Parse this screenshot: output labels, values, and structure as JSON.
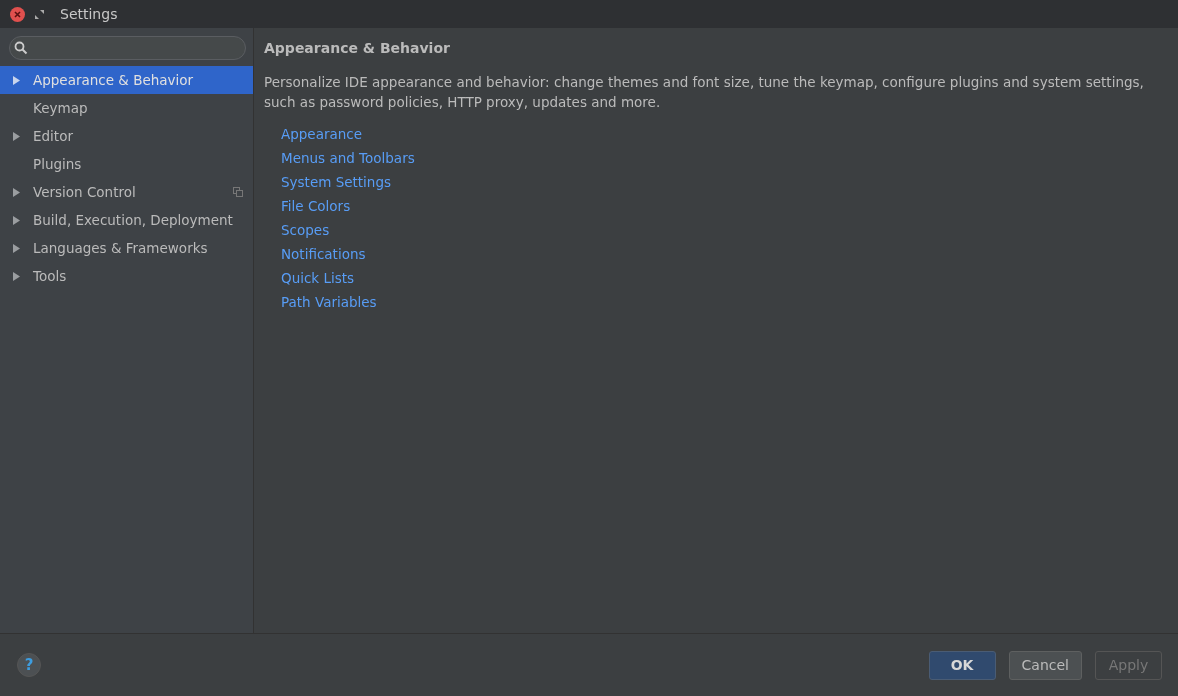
{
  "window": {
    "title": "Settings"
  },
  "sidebar": {
    "items": [
      {
        "label": "Appearance & Behavior",
        "expandable": true,
        "selected": true,
        "project_scoped": false
      },
      {
        "label": "Keymap",
        "expandable": false,
        "selected": false,
        "project_scoped": false
      },
      {
        "label": "Editor",
        "expandable": true,
        "selected": false,
        "project_scoped": false
      },
      {
        "label": "Plugins",
        "expandable": false,
        "selected": false,
        "project_scoped": false
      },
      {
        "label": "Version Control",
        "expandable": true,
        "selected": false,
        "project_scoped": true
      },
      {
        "label": "Build, Execution, Deployment",
        "expandable": true,
        "selected": false,
        "project_scoped": false
      },
      {
        "label": "Languages & Frameworks",
        "expandable": true,
        "selected": false,
        "project_scoped": false
      },
      {
        "label": "Tools",
        "expandable": true,
        "selected": false,
        "project_scoped": false
      }
    ]
  },
  "content": {
    "heading": "Appearance & Behavior",
    "description": "Personalize IDE appearance and behavior: change themes and font size, tune the keymap, configure plugins and system settings, such as password policies, HTTP proxy, updates and more.",
    "links": [
      "Appearance",
      "Menus and Toolbars",
      "System Settings",
      "File Colors",
      "Scopes",
      "Notifications",
      "Quick Lists",
      "Path Variables"
    ]
  },
  "footer": {
    "help": "?",
    "buttons": [
      {
        "label": "OK",
        "kind": "default",
        "disabled": false
      },
      {
        "label": "Cancel",
        "kind": "normal",
        "disabled": false
      },
      {
        "label": "Apply",
        "kind": "normal",
        "disabled": true
      }
    ]
  }
}
